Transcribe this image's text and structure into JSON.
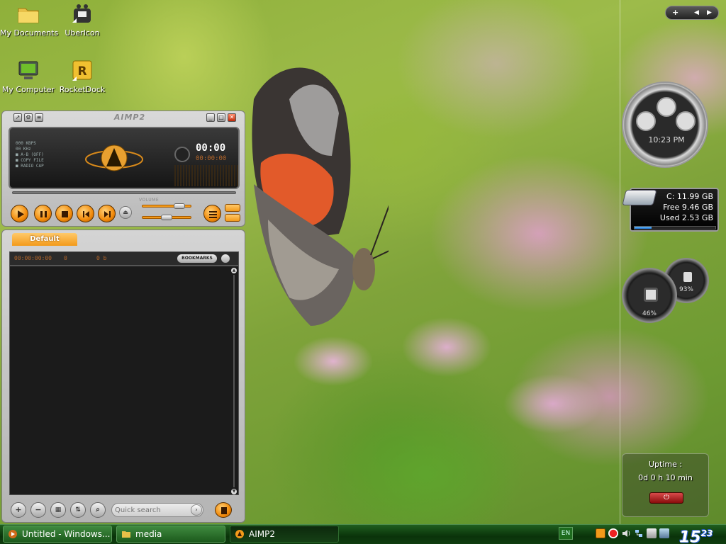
{
  "desktop_icons": [
    {
      "label": "My Documents",
      "icon": "folder-icon"
    },
    {
      "label": "UberIcon",
      "icon": "ubericon-icon"
    },
    {
      "label": "My Computer",
      "icon": "computer-icon"
    },
    {
      "label": "RocketDock",
      "icon": "rocketdock-icon"
    }
  ],
  "aimp": {
    "title": "AIMP2",
    "info_lines": [
      "000 KBPS",
      "00 KHz",
      "■ A-B (OFF)",
      "■ COPY FILE",
      "■ RADIO CAP"
    ],
    "time": "00:00",
    "time_remaining": "00:00:00",
    "volume_label": "VOLUME",
    "volume_value": 0.75,
    "balance_value": 0.5,
    "playlist_tab": "Default",
    "playlist_duration": "00:00:00:00",
    "playlist_count": "0",
    "playlist_size": "0 b",
    "bookmarks_label": "BOOKMARKS",
    "search_placeholder": "Quick search"
  },
  "gadgets": {
    "clock_time": "10:23 PM",
    "drive_label": "C:  11.99 GB",
    "drive_free": "Free 9.46 GB",
    "drive_used": "Used 2.53 GB",
    "drive_used_fraction": 0.21,
    "cpu_percent": "46%",
    "memory_percent": "93%",
    "uptime_label": "Uptime :",
    "uptime_value": "0d 0 h 10 min"
  },
  "taskbar": {
    "tasks": [
      {
        "label": "Untitled - Windows...",
        "icon": "media-player-icon"
      },
      {
        "label": "media",
        "icon": "folder-icon"
      },
      {
        "label": "AIMP2",
        "icon": "aimp-icon"
      }
    ],
    "language": "EN",
    "clock_hour": "15",
    "clock_minute": "23"
  },
  "colors": {
    "accent_orange": "#f39a1a",
    "taskbar_green": "#1f5e1f"
  }
}
